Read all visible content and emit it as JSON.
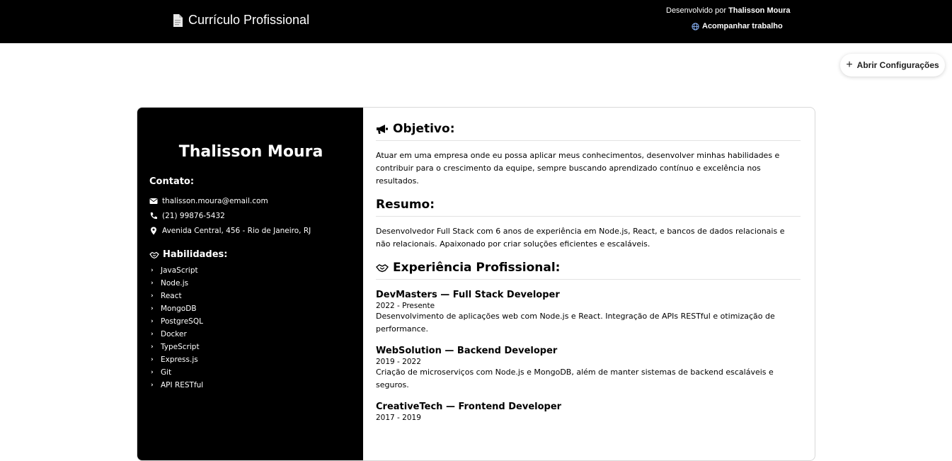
{
  "header": {
    "title": "Currículo Profissional",
    "credit_prefix": "Desenvolvido por",
    "credit_name": "Thalisson Moura",
    "follow_label": "Acompanhar trabalho"
  },
  "settings_button": {
    "label": "Abrir Configurações"
  },
  "resume": {
    "name": "Thalisson Moura",
    "contact_heading": "Contato:",
    "contact": {
      "email": "thalisson.moura@email.com",
      "phone": "(21) 99876-5432",
      "address": "Avenida Central, 456 - Rio de Janeiro, RJ"
    },
    "skills_heading": "Habilidades:",
    "skills": [
      "JavaScript",
      "Node.js",
      "React",
      "MongoDB",
      "PostgreSQL",
      "Docker",
      "TypeScript",
      "Express.js",
      "Git",
      "API RESTful"
    ],
    "objective_heading": "Objetivo:",
    "objective_text": "Atuar em uma empresa onde eu possa aplicar meus conhecimentos, desenvolver minhas habilidades e contribuir para o crescimento da equipe, sempre buscando aprendizado contínuo e excelência nos resultados.",
    "summary_heading": "Resumo:",
    "summary_text": "Desenvolvedor Full Stack com 6 anos de experiência em Node.js, React, e bancos de dados relacionais e não relacionais. Apaixonado por criar soluções eficientes e escaláveis.",
    "experience_heading": "Experiência Profissional:",
    "jobs": [
      {
        "title": "DevMasters — Full Stack Developer",
        "period": "2022 - Presente",
        "description": "Desenvolvimento de aplicações web com Node.js e React. Integração de APIs RESTful e otimização de performance."
      },
      {
        "title": "WebSolution — Backend Developer",
        "period": "2019 - 2022",
        "description": "Criação de microserviços com Node.js e MongoDB, além de manter sistemas de backend escaláveis e seguros."
      },
      {
        "title": "CreativeTech — Frontend Developer",
        "period": "2017 - 2019",
        "description": ""
      }
    ]
  }
}
